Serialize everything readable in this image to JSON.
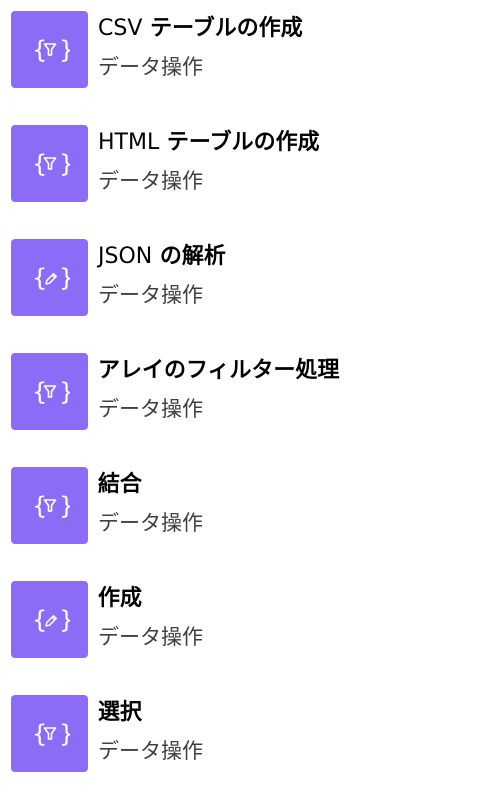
{
  "accent_color": "#8c6cf6",
  "actions": [
    {
      "title_prefix": "CSV",
      "title_main": "テーブルの作成",
      "subtitle": "データ操作",
      "icon": "filter-icon"
    },
    {
      "title_prefix": "HTML",
      "title_main": "テーブルの作成",
      "subtitle": "データ操作",
      "icon": "filter-icon"
    },
    {
      "title_prefix": "JSON",
      "title_main": "の解析",
      "subtitle": "データ操作",
      "icon": "pencil-icon"
    },
    {
      "title_prefix": "",
      "title_main": "アレイのフィルター処理",
      "subtitle": "データ操作",
      "icon": "filter-icon"
    },
    {
      "title_prefix": "",
      "title_main": "結合",
      "subtitle": "データ操作",
      "icon": "filter-icon"
    },
    {
      "title_prefix": "",
      "title_main": "作成",
      "subtitle": "データ操作",
      "icon": "pencil-icon"
    },
    {
      "title_prefix": "",
      "title_main": "選択",
      "subtitle": "データ操作",
      "icon": "filter-icon"
    }
  ]
}
